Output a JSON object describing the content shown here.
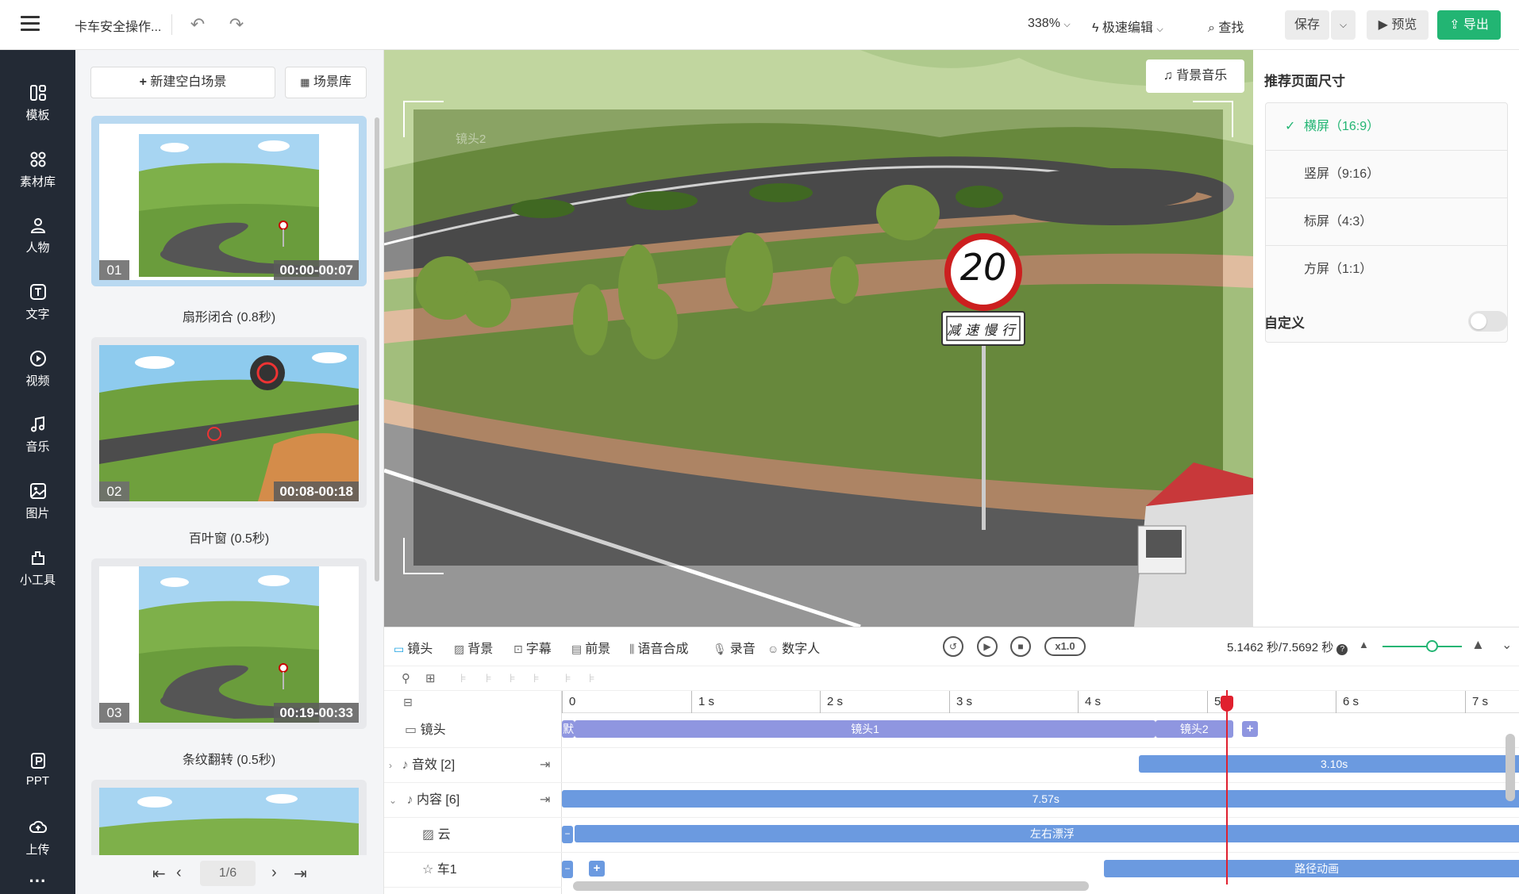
{
  "topbar": {
    "title": "卡车安全操作...",
    "zoom": "338%",
    "edit_mode": "极速编辑",
    "find": "查找",
    "save": "保存",
    "preview": "预览",
    "export": "导出"
  },
  "sidebar": {
    "items": [
      {
        "label": "模板",
        "icon": "template-icon"
      },
      {
        "label": "素材库",
        "icon": "material-icon"
      },
      {
        "label": "人物",
        "icon": "person-icon"
      },
      {
        "label": "文字",
        "icon": "text-icon"
      },
      {
        "label": "视频",
        "icon": "video-icon"
      },
      {
        "label": "音乐",
        "icon": "music-icon"
      },
      {
        "label": "图片",
        "icon": "image-icon"
      },
      {
        "label": "小工具",
        "icon": "tool-icon"
      }
    ],
    "ppt": "PPT",
    "upload": "上传",
    "more": "···"
  },
  "scenes": {
    "new_blank": "新建空白场景",
    "library": "场景库",
    "items": [
      {
        "num": "01",
        "time": "00:00-00:07",
        "transition": "扇形闭合 (0.8秒)"
      },
      {
        "num": "02",
        "time": "00:08-00:18",
        "transition": "百叶窗 (0.5秒)"
      },
      {
        "num": "03",
        "time": "00:19-00:33",
        "transition": "条纹翻转 (0.5秒)"
      }
    ],
    "page": "1/6"
  },
  "canvas": {
    "bgm": "背景音乐",
    "camera_label": "镜头2",
    "speed_sign": "20",
    "slow_sign": "减速慢行"
  },
  "right_panel": {
    "title": "推荐页面尺寸",
    "sizes": [
      "横屏（16:9）",
      "竖屏（9:16）",
      "标屏（4:3）",
      "方屏（1:1）"
    ],
    "selected": "横屏（16:9）",
    "custom_label": "自定义",
    "custom_enabled": false
  },
  "timeline": {
    "tabs": [
      "镜头",
      "背景",
      "字幕",
      "前景",
      "语音合成",
      "录音",
      "数字人"
    ],
    "speed": "x1.0",
    "time_readout": "5.1462 秒/7.5692 秒",
    "zoom_level": 0.62,
    "ruler": [
      "0",
      "1 s",
      "2 s",
      "3 s",
      "4 s",
      "5",
      "6 s",
      "7 s"
    ],
    "playhead_seconds": 5.15,
    "rows": [
      {
        "label": "镜头",
        "clips": [
          {
            "name": "默",
            "start": 0,
            "end": 0.1
          },
          {
            "name": "镜头1",
            "start": 0.1,
            "end": 4.6
          },
          {
            "name": "镜头2",
            "start": 4.6,
            "end": 5.2
          }
        ]
      },
      {
        "label": "音效 [2]",
        "clips": [
          {
            "name": "3.10s",
            "start": 4.47,
            "end": 7.5
          }
        ]
      },
      {
        "label": "内容 [6]",
        "clips": [
          {
            "name": "7.57s",
            "start": 0,
            "end": 7.5
          }
        ]
      },
      {
        "label": "云",
        "clips": [
          {
            "name": "左右漂浮",
            "start": 0.1,
            "end": 7.5
          }
        ]
      },
      {
        "label": "车1",
        "clips": [
          {
            "name": "路径动画",
            "start": 4.2,
            "end": 7.5
          }
        ]
      }
    ]
  },
  "colors": {
    "sidebar_bg": "#232a35",
    "accent_green": "#22b573",
    "clip_purple": "#8f96e0",
    "clip_blue": "#6b9ae0",
    "playhead": "#e0202e"
  }
}
